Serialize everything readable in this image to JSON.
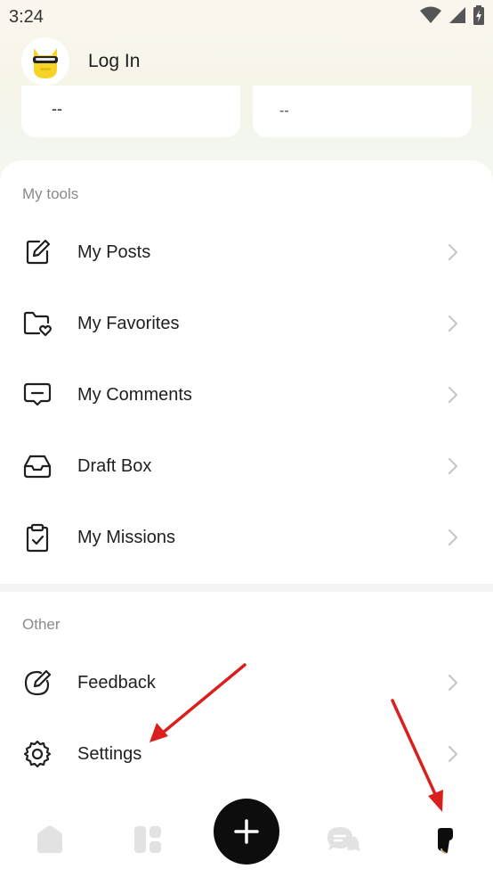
{
  "status_bar": {
    "time": "3:24",
    "icons": [
      "wifi-icon",
      "signal-icon",
      "battery-charging-icon"
    ]
  },
  "profile": {
    "avatar_icon": "mascot-avatar",
    "login_label": "Log In"
  },
  "stats": [
    {
      "value": "--"
    },
    {
      "value": "--"
    }
  ],
  "sections": {
    "my_tools": {
      "title": "My tools",
      "items": [
        {
          "label": "My Posts",
          "icon": "edit-note-icon"
        },
        {
          "label": "My Favorites",
          "icon": "folder-heart-icon"
        },
        {
          "label": "My Comments",
          "icon": "comment-icon"
        },
        {
          "label": "Draft Box",
          "icon": "inbox-tray-icon"
        },
        {
          "label": "My Missions",
          "icon": "clipboard-check-icon"
        }
      ]
    },
    "other": {
      "title": "Other",
      "items": [
        {
          "label": "Feedback",
          "icon": "pencil-circle-icon"
        },
        {
          "label": "Settings",
          "icon": "gear-icon"
        }
      ]
    }
  },
  "bottom_nav": {
    "items": [
      "home-icon",
      "dashboard-icon",
      "add-icon",
      "messages-icon",
      "profile-icon"
    ]
  },
  "colors": {
    "fab": "#0d0d0d",
    "annotation_arrow": "#d9201f",
    "nav_icon_inactive": "#e2e2e2",
    "chevron": "#c4c4c4",
    "section_title": "#8a8a8a"
  }
}
